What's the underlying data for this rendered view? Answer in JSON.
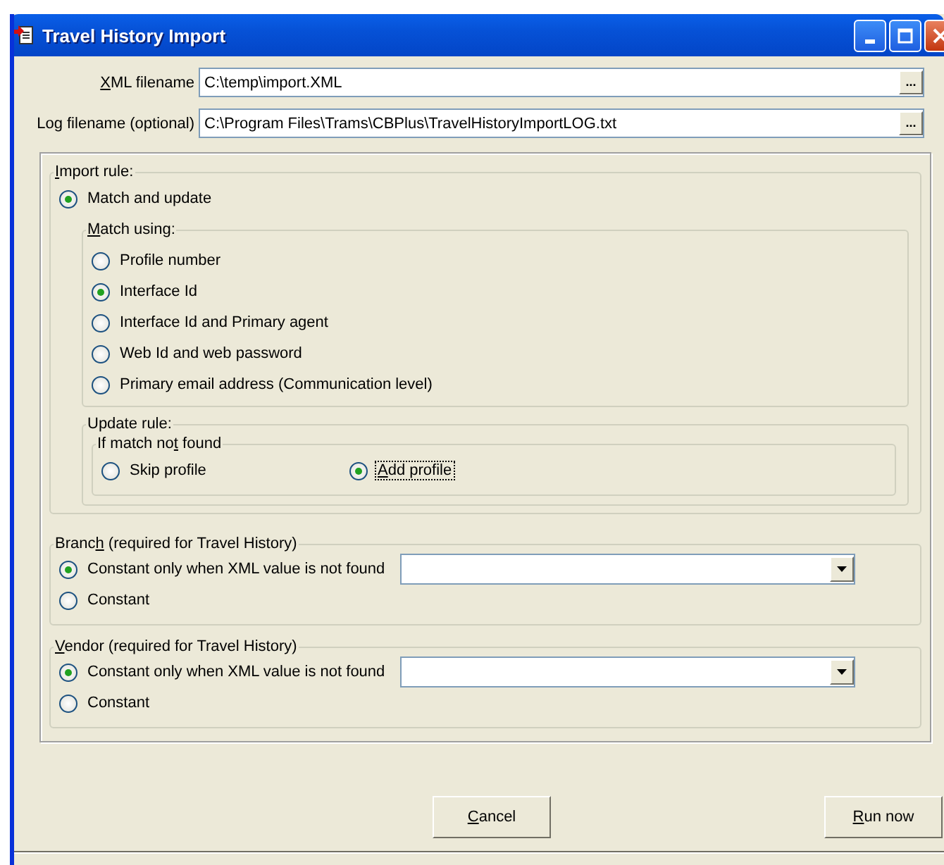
{
  "window": {
    "title": "Travel History Import"
  },
  "fields": [
    {
      "mnemonic": "X",
      "label_after": "ML filename",
      "value": "C:\\temp\\import.XML",
      "browse": "..."
    },
    {
      "label": "Log filename (optional)",
      "value": "C:\\Program Files\\Trams\\CBPlus\\TravelHistoryImportLOG.txt",
      "browse": "..."
    }
  ],
  "import_rule": {
    "mnemonic": "I",
    "label_after": "mport rule:",
    "option": {
      "label": "Match and update",
      "selected": true
    },
    "match_using": {
      "mnemonic": "M",
      "label_after": "atch using:",
      "options": [
        {
          "label": "Profile number",
          "selected": false
        },
        {
          "label": "Interface Id",
          "selected": true
        },
        {
          "label": "Interface Id and Primary agent",
          "selected": false
        },
        {
          "label": "Web Id and web password",
          "selected": false
        },
        {
          "label": "Primary email address (Communication level)",
          "selected": false
        }
      ]
    },
    "update_rule": {
      "label": "Update rule:",
      "if_not_found": {
        "label_before": "If match no",
        "mnemonic": "t",
        "label_after": " found",
        "options": [
          {
            "label": "Skip profile",
            "selected": false,
            "focused": false
          },
          {
            "mnemonic": "A",
            "label_after": "dd profile",
            "selected": true,
            "focused": true
          }
        ]
      }
    }
  },
  "constant_groups": [
    {
      "label_before": "Branc",
      "mnemonic": "h",
      "label_after": " (required for Travel History)",
      "options": [
        {
          "label": "Constant only when XML value is not found",
          "selected": true
        },
        {
          "label": "Constant",
          "selected": false
        }
      ]
    },
    {
      "mnemonic": "V",
      "label_after": "endor (required for Travel History)",
      "options": [
        {
          "label": "Constant only when XML value is not found",
          "selected": true
        },
        {
          "label": "Constant",
          "selected": false
        }
      ]
    }
  ],
  "buttons": [
    {
      "mnemonic": "C",
      "label_after": "ancel"
    },
    {
      "mnemonic": "R",
      "label_after": "un now"
    }
  ]
}
